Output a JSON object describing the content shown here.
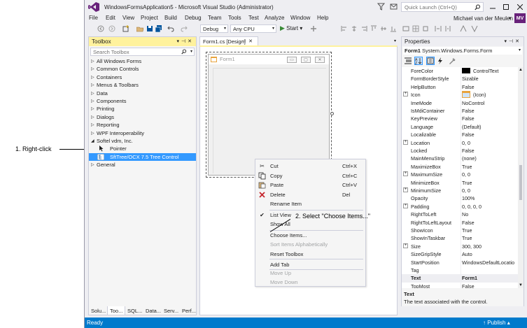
{
  "annotations": {
    "right_click": "1. Right-click",
    "choose_items": "2. Select \"Choose Items...\""
  },
  "window": {
    "title": "WindowsFormsApplication5 - Microsoft Visual Studio (Administrator)",
    "quick_launch_placeholder": "Quick Launch (Ctrl+Q)",
    "user_name": "Michael van der Meulen",
    "avatar_initials": "MV",
    "accent_color": "#68217a"
  },
  "menu": [
    "File",
    "Edit",
    "View",
    "Project",
    "Build",
    "Debug",
    "Team",
    "Tools",
    "Test",
    "Analyze",
    "Window",
    "Help"
  ],
  "toolbar": {
    "config": "Debug",
    "platform": "Any CPU",
    "start_label": "Start"
  },
  "toolbox": {
    "title": "Toolbox",
    "search_placeholder": "Search Toolbox",
    "items": [
      {
        "label": "All Windows Forms",
        "expanded": false
      },
      {
        "label": "Common Controls",
        "expanded": false
      },
      {
        "label": "Containers",
        "expanded": false
      },
      {
        "label": "Menus & Toolbars",
        "expanded": false
      },
      {
        "label": "Data",
        "expanded": false
      },
      {
        "label": "Components",
        "expanded": false
      },
      {
        "label": "Printing",
        "expanded": false
      },
      {
        "label": "Dialogs",
        "expanded": false
      },
      {
        "label": "Reporting",
        "expanded": false
      },
      {
        "label": "WPF Interoperability",
        "expanded": false
      },
      {
        "label": "Softel vdm, Inc.",
        "expanded": true
      },
      {
        "label": "Pointer",
        "child": true
      },
      {
        "label": "SftTree/OCX 7.5 Tree Control",
        "child": true,
        "selected": true
      },
      {
        "label": "General",
        "expanded": false
      }
    ],
    "bottom_tabs": [
      "Solu...",
      "Too...",
      "SQL...",
      "Data...",
      "Serv...",
      "Perf..."
    ],
    "header_color": "#fff29d"
  },
  "designer": {
    "tab_label": "Form1.cs [Design]",
    "form_title": "Form1",
    "form_buttons": [
      "▭",
      "▢",
      "✕"
    ]
  },
  "context_menu": {
    "items": [
      {
        "label": "Cut",
        "shortcut": "Ctrl+X",
        "icon": "scissors-icon",
        "disabled": false
      },
      {
        "label": "Copy",
        "shortcut": "Ctrl+C",
        "icon": "copy-icon",
        "disabled": false
      },
      {
        "label": "Paste",
        "shortcut": "Ctrl+V",
        "icon": "paste-icon",
        "disabled": false
      },
      {
        "label": "Delete",
        "shortcut": "Del",
        "icon": "delete-icon",
        "disabled": false
      },
      {
        "label": "Rename Item",
        "shortcut": "",
        "disabled": false
      },
      {
        "label": "List View",
        "shortcut": "",
        "icon": "check-icon",
        "disabled": false
      },
      {
        "label": "Show All",
        "shortcut": "",
        "disabled": false
      },
      {
        "label": "Choose Items...",
        "shortcut": "",
        "disabled": false
      },
      {
        "label": "Sort Items Alphabetically",
        "shortcut": "",
        "disabled": true
      },
      {
        "label": "Reset Toolbox",
        "shortcut": "",
        "disabled": false
      },
      {
        "label": "Add Tab",
        "shortcut": "",
        "disabled": false
      },
      {
        "label": "Move Up",
        "shortcut": "",
        "disabled": true
      },
      {
        "label": "Move Down",
        "shortcut": "",
        "disabled": true
      }
    ]
  },
  "properties": {
    "title": "Properties",
    "object_name": "Form1",
    "object_type": "System.Windows.Forms.Form",
    "rows": [
      {
        "name": "ForeColor",
        "value": "ControlText",
        "swatch": "#000000"
      },
      {
        "name": "FormBorderStyle",
        "value": "Sizable"
      },
      {
        "name": "HelpButton",
        "value": "False"
      },
      {
        "name": "Icon",
        "value": "(Icon)",
        "expandable": true,
        "icon": "form-icon"
      },
      {
        "name": "ImeMode",
        "value": "NoControl"
      },
      {
        "name": "IsMdiContainer",
        "value": "False"
      },
      {
        "name": "KeyPreview",
        "value": "False"
      },
      {
        "name": "Language",
        "value": "(Default)"
      },
      {
        "name": "Localizable",
        "value": "False"
      },
      {
        "name": "Location",
        "value": "0, 0",
        "expandable": true
      },
      {
        "name": "Locked",
        "value": "False"
      },
      {
        "name": "MainMenuStrip",
        "value": "(none)"
      },
      {
        "name": "MaximizeBox",
        "value": "True"
      },
      {
        "name": "MaximumSize",
        "value": "0, 0",
        "expandable": true
      },
      {
        "name": "MinimizeBox",
        "value": "True"
      },
      {
        "name": "MinimumSize",
        "value": "0, 0",
        "expandable": true
      },
      {
        "name": "Opacity",
        "value": "100%"
      },
      {
        "name": "Padding",
        "value": "0, 0, 0, 0",
        "expandable": true
      },
      {
        "name": "RightToLeft",
        "value": "No"
      },
      {
        "name": "RightToLeftLayout",
        "value": "False"
      },
      {
        "name": "ShowIcon",
        "value": "True"
      },
      {
        "name": "ShowInTaskbar",
        "value": "True"
      },
      {
        "name": "Size",
        "value": "300, 300",
        "expandable": true
      },
      {
        "name": "SizeGripStyle",
        "value": "Auto"
      },
      {
        "name": "StartPosition",
        "value": "WindowsDefaultLocatio"
      },
      {
        "name": "Tag",
        "value": ""
      },
      {
        "name": "Text",
        "value": "Form1",
        "selected": true
      },
      {
        "name": "TopMost",
        "value": "False"
      }
    ],
    "description_title": "Text",
    "description_text": "The text associated with the control."
  },
  "status": {
    "text": "Ready",
    "publish_label": "Publish",
    "bar_color": "#007acc"
  }
}
